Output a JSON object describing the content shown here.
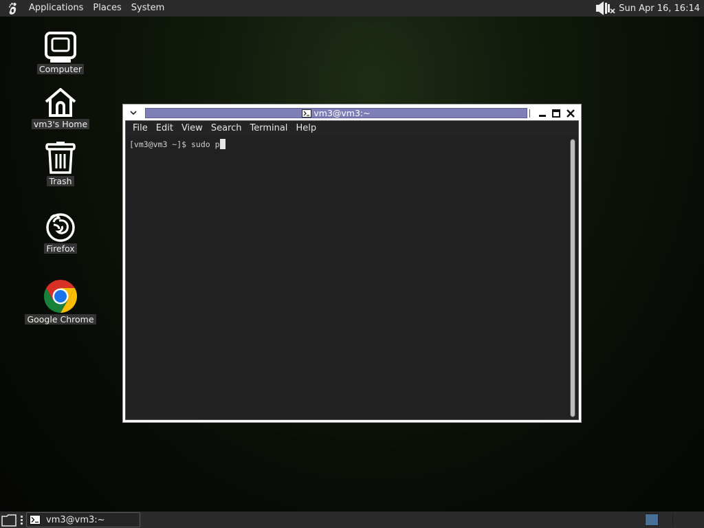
{
  "top_panel": {
    "menus": [
      "Applications",
      "Places",
      "System"
    ],
    "clock": "Sun Apr 16, 16:14"
  },
  "desktop_icons": [
    {
      "label": "Computer",
      "icon": "computer-icon"
    },
    {
      "label": "vm3's Home",
      "icon": "home-folder-icon"
    },
    {
      "label": "Trash",
      "icon": "trash-icon"
    },
    {
      "label": "Firefox",
      "icon": "firefox-icon"
    },
    {
      "label": "Google Chrome",
      "icon": "chrome-icon"
    }
  ],
  "terminal_window": {
    "title": "vm3@vm3:~",
    "menus": [
      "File",
      "Edit",
      "View",
      "Search",
      "Terminal",
      "Help"
    ],
    "content": "[vm3@vm3 ~]$ sudo p"
  },
  "bottom_panel": {
    "task_label": "vm3@vm3:~"
  },
  "colors": {
    "panel_bg": "#2b2b2b",
    "titlebar_accent": "#7f7fb8",
    "terminal_bg": "#212121",
    "workspace_active": "#4a6f96"
  }
}
